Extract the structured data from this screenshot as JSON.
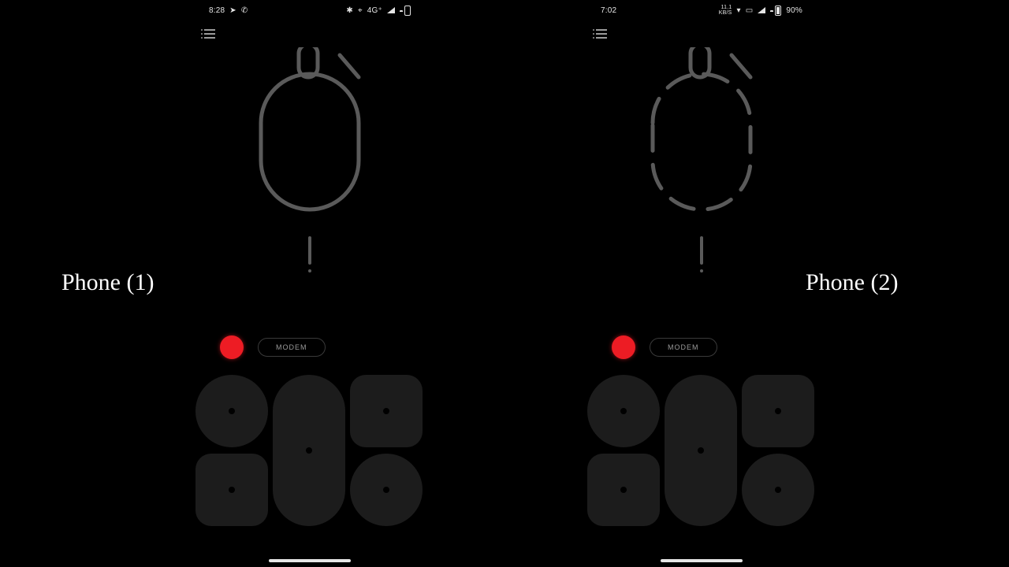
{
  "labels": {
    "phone1": "Phone (1)",
    "phone2": "Phone (2)"
  },
  "left": {
    "status": {
      "time": "8:28",
      "left_icons": "▷  📞",
      "right_icons": "✱  ◎  4G⁺",
      "battery_pct": ""
    },
    "modem": {
      "rec_color": "#ed1c24",
      "label": "MODEM"
    }
  },
  "right": {
    "status": {
      "time": "7:02",
      "kbs": "11.1\nKB/S",
      "right_icons": "",
      "battery_pct": "90%"
    },
    "modem": {
      "rec_color": "#ed1c24",
      "label": "MODEM"
    }
  },
  "colors": {
    "glyph_stroke": "#5a5a5a",
    "tile_bg": "#1c1c1c",
    "accent": "#ed1c24"
  }
}
